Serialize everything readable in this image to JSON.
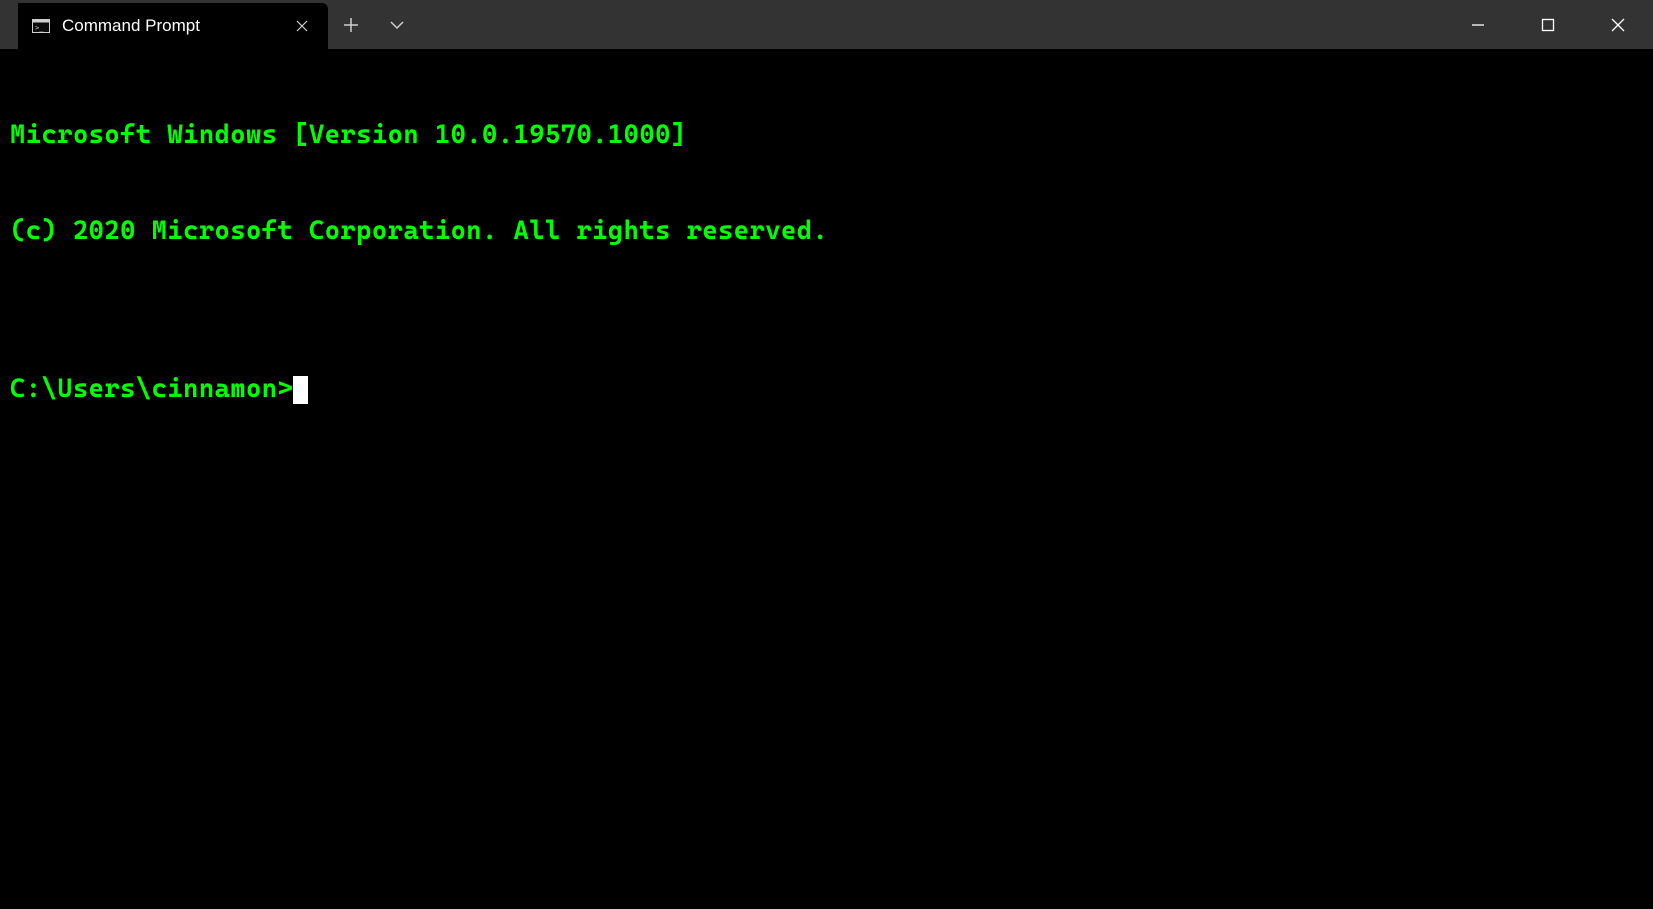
{
  "colors": {
    "title_bar_bg": "#333333",
    "tab_bg": "#000000",
    "terminal_bg": "#000000",
    "terminal_fg": "#00ff00",
    "cursor": "#ffffff",
    "ctrl_fg": "#ffffff"
  },
  "icons": {
    "tab_icon": "terminal-icon",
    "close": "close-icon",
    "new_tab": "plus-icon",
    "tabs_dropdown": "chevron-down-icon",
    "minimize": "minimize-icon",
    "maximize": "maximize-icon",
    "window_close": "close-icon"
  },
  "tabs": [
    {
      "title": "Command Prompt",
      "active": true
    }
  ],
  "terminal": {
    "lines": [
      "Microsoft Windows [Version 10.0.19570.1000]",
      "(c) 2020 Microsoft Corporation. All rights reserved.",
      ""
    ],
    "prompt": "C:\\Users\\cinnamon>",
    "input": ""
  }
}
